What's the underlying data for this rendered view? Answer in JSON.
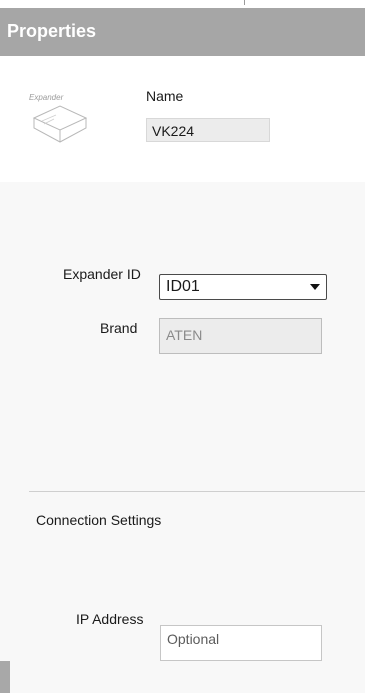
{
  "panel": {
    "title": "Properties"
  },
  "device": {
    "icon": "expander-device-icon",
    "icon_label": "Expander",
    "name_label": "Name",
    "name_value": "VK224"
  },
  "fields": {
    "expander_id_label": "Expander ID",
    "expander_id_value": "ID01",
    "brand_label": "Brand",
    "brand_value": "ATEN"
  },
  "connection": {
    "section_title": "Connection Settings",
    "ip_label": "IP Address",
    "ip_placeholder": "Optional"
  },
  "colors": {
    "title_bar": "#a6a6a6",
    "title_text": "#ffffff",
    "panel_background": "#f8f8f8",
    "header_background": "#ffffff",
    "readonly_field": "#ececec"
  }
}
